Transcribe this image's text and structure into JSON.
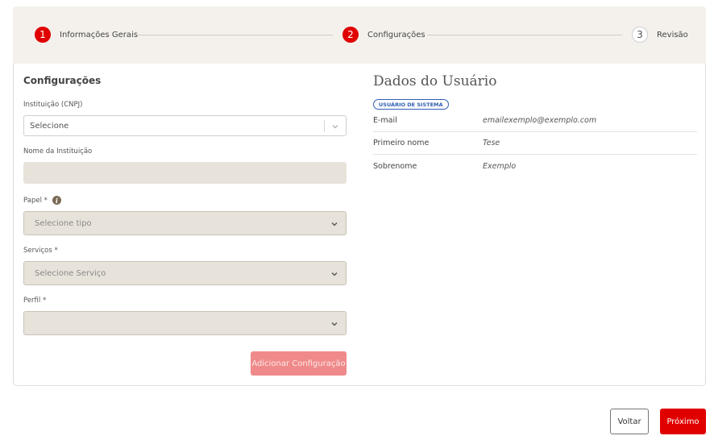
{
  "stepper": {
    "steps": [
      {
        "number": "1",
        "label": "Informações Gerais",
        "state": "active"
      },
      {
        "number": "2",
        "label": "Configurações",
        "state": "active"
      },
      {
        "number": "3",
        "label": "Revisão",
        "state": "inactive"
      }
    ]
  },
  "form": {
    "title": "Configurações",
    "instituicao": {
      "label": "Instituição (CNPJ)",
      "placeholder": "Selecione"
    },
    "nome_instituicao": {
      "label": "Nome da Instituição",
      "value": ""
    },
    "papel": {
      "label": "Papel *",
      "placeholder": "Selecione tipo",
      "icon": "info-icon"
    },
    "servicos": {
      "label": "Serviços *",
      "placeholder": "Selecione Serviço"
    },
    "perfil": {
      "label": "Perfil *",
      "placeholder": ""
    },
    "add_button": "Adicionar Configuração"
  },
  "user": {
    "title": "Dados do Usuário",
    "badge": "USUÁRIO DE SISTEMA",
    "rows": [
      {
        "key": "E-mail",
        "value": "emailexemplo@exemplo.com"
      },
      {
        "key": "Primeiro nome",
        "value": "Tese"
      },
      {
        "key": "Sobrenome",
        "value": "Exemplo"
      }
    ]
  },
  "footer": {
    "back_label": "Voltar",
    "next_label": "Próximo"
  },
  "colors": {
    "accent": "#e00000",
    "disabled_button": "#f08a8a",
    "stepper_bg": "#f4f1ec",
    "field_bg": "#e8e3da",
    "badge": "#2f5fb3"
  }
}
